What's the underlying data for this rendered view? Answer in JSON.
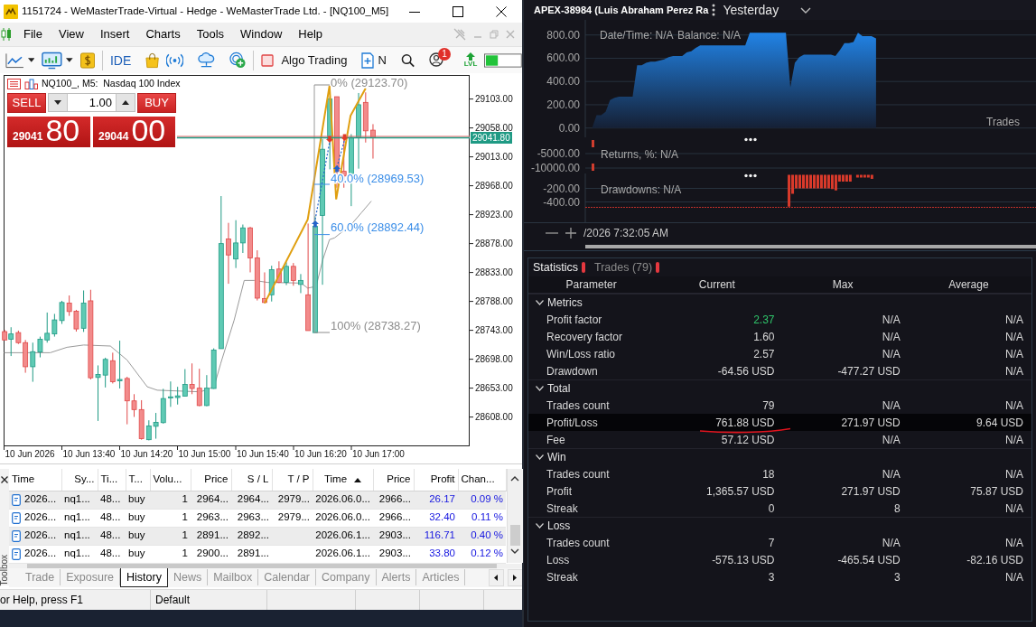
{
  "window": {
    "title": "1151724 - WeMasterTrade-Virtual - Hedge - WeMasterTrade Ltd. - [NQ100_M5]"
  },
  "menu": [
    "File",
    "View",
    "Insert",
    "Charts",
    "Tools",
    "Window",
    "Help"
  ],
  "toolbar": {
    "ide": "IDE",
    "algo_trading": {
      "label": "Algo Trading",
      "on": false
    },
    "new_order": "N",
    "notifications": "1",
    "level_badge": "LVL"
  },
  "chart": {
    "title": "NQ100_, M5:  Nasdaq 100 Index",
    "one_click": {
      "sell": "SELL",
      "buy": "BUY",
      "volume": "1.00",
      "bid": {
        "main": "29041",
        "pips": "80"
      },
      "ask": {
        "main": "29044",
        "pips": "00"
      }
    },
    "price_ticks": [
      "29103.00",
      "29058.00",
      "29013.00",
      "28968.00",
      "28923.00",
      "28878.00",
      "28833.00",
      "28788.00",
      "28743.00",
      "28698.00",
      "28653.00",
      "28608.00"
    ],
    "current_price": "29041.80",
    "time_ticks": [
      "10 Jun 2026",
      "10 Jun 13:40",
      "10 Jun 14:20",
      "10 Jun 15:00",
      "10 Jun 15:40",
      "10 Jun 16:20",
      "10 Jun 17:00"
    ],
    "fibonacci": [
      {
        "label": "0% (29123.70)",
        "kind": "edge"
      },
      {
        "label": "40.0% (28969.53)",
        "kind": "inner"
      },
      {
        "label": "60.0% (28892.44)",
        "kind": "inner"
      },
      {
        "label": "100% (28738.27)",
        "kind": "edge"
      }
    ]
  },
  "toolbox": {
    "side_label": "Toolbox",
    "columns": [
      {
        "label": "Time",
        "sorted": false
      },
      {
        "label": "Sy...",
        "sorted": false
      },
      {
        "label": "Ti...",
        "sorted": false
      },
      {
        "label": "T...",
        "sorted": false
      },
      {
        "label": "Volu...",
        "sorted": false
      },
      {
        "label": "Price",
        "sorted": false
      },
      {
        "label": "S / L",
        "sorted": false
      },
      {
        "label": "T / P",
        "sorted": false
      },
      {
        "label": "Time",
        "sorted": true
      },
      {
        "label": "Price",
        "sorted": false
      },
      {
        "label": "Profit",
        "sorted": false
      },
      {
        "label": "Chan...",
        "sorted": false
      }
    ],
    "rows": [
      [
        "2026...",
        "nq1...",
        "48...",
        "buy",
        "1",
        "2964...",
        "2964...",
        "2979...",
        "2026.06.0...",
        "2966...",
        "26.17",
        "0.09 %"
      ],
      [
        "2026...",
        "nq1...",
        "48...",
        "buy",
        "1",
        "2963...",
        "2963...",
        "2979...",
        "2026.06.0...",
        "2966...",
        "32.40",
        "0.11 %"
      ],
      [
        "2026...",
        "nq1...",
        "48...",
        "buy",
        "1",
        "2891...",
        "2892...",
        null,
        "2026.06.1...",
        "2903...",
        "116.71",
        "0.40 %"
      ],
      [
        "2026...",
        "nq1...",
        "48...",
        "buy",
        "1",
        "2900...",
        "2891...",
        null,
        "2026.06.1...",
        "2903...",
        "33.80",
        "0.12 %"
      ]
    ],
    "tabs": [
      {
        "label": "Trade",
        "selected": false
      },
      {
        "label": "Exposure",
        "selected": false
      },
      {
        "label": "History",
        "selected": true
      },
      {
        "label": "News",
        "selected": false
      },
      {
        "label": "Mailbox",
        "selected": false
      },
      {
        "label": "Calendar",
        "selected": false
      },
      {
        "label": "Company",
        "selected": false
      },
      {
        "label": "Alerts",
        "selected": false
      },
      {
        "label": "Articles",
        "selected": false
      }
    ]
  },
  "status_bar": [
    "or Help, press F1",
    "Default"
  ],
  "report": {
    "account": "APEX-38984 (Luis Abraham Perez Ra",
    "period": "Yesterday",
    "equity": {
      "info": [
        "Date/Time: N/A",
        "Balance: N/A"
      ],
      "axis_title": "Trades",
      "chart_data": {
        "type": "area",
        "categories": [
          null,
          null,
          null,
          null,
          null,
          null,
          null,
          null,
          null,
          null,
          null,
          null,
          null,
          null,
          null,
          null,
          null,
          null,
          null,
          null,
          null,
          null,
          null,
          null,
          null,
          null,
          null,
          null,
          null,
          null,
          null,
          null,
          null,
          null,
          null,
          null,
          null,
          null,
          null,
          null,
          null,
          null,
          null,
          null,
          null,
          null,
          null,
          null,
          null,
          null,
          null,
          null,
          null,
          null,
          null,
          null,
          null,
          null,
          null,
          null,
          null,
          null,
          null,
          null,
          null,
          null,
          null,
          null,
          null,
          null,
          null,
          null,
          null,
          null,
          null,
          null,
          null,
          null,
          null,
          null,
          null,
          null,
          null,
          null,
          null,
          null,
          null,
          null,
          null,
          null,
          null,
          null,
          null,
          null,
          null,
          null,
          null,
          null,
          null,
          null
        ],
        "values": [
          0,
          0,
          110,
          110,
          140,
          240,
          260,
          270,
          270,
          270,
          270,
          540,
          540,
          560,
          570,
          570,
          580,
          590,
          610,
          620,
          620,
          620,
          650,
          660,
          690,
          710,
          710,
          710,
          710,
          710,
          710,
          710,
          710,
          710,
          710,
          710,
          820,
          820,
          820,
          820,
          820,
          820,
          820,
          820,
          820,
          350,
          560,
          610,
          630,
          630,
          630,
          630,
          630,
          630,
          630,
          620,
          670,
          730,
          730,
          740,
          820,
          790,
          790,
          790,
          770,
          null,
          null,
          null,
          null,
          null,
          null,
          null,
          null,
          null,
          null,
          null,
          null,
          null,
          null,
          null,
          null,
          null,
          null,
          null,
          null,
          null,
          null,
          null,
          null,
          null,
          null,
          null,
          null,
          null,
          null,
          null,
          null,
          null,
          null,
          null
        ],
        "ylim": [
          -80,
          930
        ],
        "yticks": [
          {
            "value": 800,
            "label": "800.00"
          },
          {
            "value": 600,
            "label": "600.00"
          },
          {
            "value": 400,
            "label": "400.00"
          },
          {
            "value": 200,
            "label": "200.00"
          },
          {
            "value": 0,
            "label": "0.00"
          }
        ],
        "grid": true
      }
    },
    "returns": {
      "info": "Returns, %: N/A",
      "tick_labels": [
        "-5000.00",
        "-10000.00"
      ]
    },
    "drawdowns": {
      "info": "Drawdowns: N/A",
      "chart_data": {
        "type": "bar",
        "categories": [
          null,
          null,
          null,
          null,
          null,
          null,
          null,
          null,
          null,
          null,
          null,
          null,
          null,
          null,
          null,
          null,
          null,
          null,
          null,
          null,
          null,
          null,
          null,
          null,
          null,
          null,
          null,
          null,
          null,
          null,
          null,
          null,
          null,
          null,
          null,
          null,
          null,
          null,
          null,
          null,
          null,
          null,
          null,
          null,
          null,
          null,
          null,
          null,
          null,
          null,
          null,
          null,
          null,
          null,
          null,
          null,
          null,
          null,
          null,
          null,
          null,
          null,
          null,
          null,
          null,
          null,
          null,
          null,
          null,
          null,
          null,
          null,
          null,
          null,
          null,
          null,
          null,
          null,
          null,
          null,
          null,
          null,
          null,
          null,
          null,
          null,
          null,
          null,
          null,
          null,
          null,
          null,
          null,
          null,
          null,
          null,
          null,
          null,
          null,
          null,
          null,
          null,
          null,
          null,
          null,
          null,
          null,
          null,
          null,
          null,
          null,
          null,
          null,
          null,
          null,
          null,
          null,
          null,
          null,
          null,
          null,
          null,
          null,
          null,
          null
        ],
        "values": [
          null,
          null,
          null,
          null,
          null,
          null,
          null,
          null,
          null,
          null,
          null,
          null,
          null,
          null,
          null,
          null,
          null,
          null,
          null,
          null,
          null,
          null,
          null,
          null,
          null,
          null,
          null,
          null,
          null,
          null,
          null,
          null,
          null,
          null,
          null,
          null,
          null,
          null,
          null,
          null,
          null,
          null,
          null,
          null,
          null,
          null,
          null,
          null,
          null,
          null,
          null,
          null,
          null,
          null,
          null,
          null,
          -470,
          -280,
          -200,
          -200,
          -200,
          -200,
          -200,
          -200,
          -200,
          -200,
          -200,
          -200,
          -210,
          -230,
          -100,
          -100,
          -100,
          -100,
          null,
          -40,
          -40,
          -40,
          -40,
          -60,
          null,
          null,
          null,
          null,
          null,
          null,
          null,
          null,
          null,
          null,
          null,
          null,
          null,
          null,
          null,
          null,
          null,
          null,
          null,
          null,
          null,
          null,
          null,
          null,
          null,
          null,
          null,
          null,
          null,
          null,
          null,
          null,
          null,
          null,
          null,
          null,
          null,
          null,
          null,
          null,
          null,
          null,
          null,
          null,
          null
        ],
        "ylim": [
          -700,
          20
        ],
        "yticks": [
          {
            "value": -200,
            "label": "-200.00"
          },
          {
            "value": -400,
            "label": "-400.00"
          }
        ],
        "grid": true,
        "ref_lines": [
          {
            "axis": "y",
            "value": -480
          }
        ]
      }
    },
    "timestamp": "/2026 7:32:05 AM",
    "stats": {
      "tabs": [
        {
          "label": "Statistics",
          "selected": true
        },
        {
          "label": "Trades (79)",
          "selected": false
        }
      ],
      "columns": [
        "Parameter",
        "Current",
        "Max",
        "Average"
      ],
      "groups": [
        {
          "title": "Metrics",
          "expanded": true,
          "rows": [
            {
              "parameter": "Profit factor",
              "current": "2.37",
              "max": "N/A",
              "average": "N/A",
              "selected": false,
              "positive": true,
              "underlined": false
            },
            {
              "parameter": "Recovery factor",
              "current": "1.60",
              "max": "N/A",
              "average": "N/A",
              "selected": false,
              "positive": false,
              "underlined": false
            },
            {
              "parameter": "Win/Loss ratio",
              "current": "2.57",
              "max": "N/A",
              "average": "N/A",
              "selected": false,
              "positive": false,
              "underlined": false
            },
            {
              "parameter": "Drawdown",
              "current": "-64.56 USD",
              "max": "-477.27 USD",
              "average": "N/A",
              "selected": false,
              "positive": false,
              "underlined": false
            }
          ]
        },
        {
          "title": "Total",
          "expanded": true,
          "rows": [
            {
              "parameter": "Trades count",
              "current": "79",
              "max": "N/A",
              "average": "N/A",
              "selected": false,
              "positive": false,
              "underlined": false
            },
            {
              "parameter": "Profit/Loss",
              "current": "761.88 USD",
              "max": "271.97 USD",
              "average": "9.64 USD",
              "selected": true,
              "positive": false,
              "underlined": true
            },
            {
              "parameter": "Fee",
              "current": "57.12 USD",
              "max": "N/A",
              "average": "N/A",
              "selected": false,
              "positive": false,
              "underlined": false
            }
          ]
        },
        {
          "title": "Win",
          "expanded": true,
          "rows": [
            {
              "parameter": "Trades count",
              "current": "18",
              "max": "N/A",
              "average": "N/A",
              "selected": false,
              "positive": false,
              "underlined": false
            },
            {
              "parameter": "Profit",
              "current": "1,365.57 USD",
              "max": "271.97 USD",
              "average": "75.87 USD",
              "selected": false,
              "positive": false,
              "underlined": false
            },
            {
              "parameter": "Streak",
              "current": "0",
              "max": "8",
              "average": "N/A",
              "selected": false,
              "positive": false,
              "underlined": false
            }
          ]
        },
        {
          "title": "Loss",
          "expanded": true,
          "rows": [
            {
              "parameter": "Trades count",
              "current": "7",
              "max": "N/A",
              "average": "N/A",
              "selected": false,
              "positive": false,
              "underlined": false
            },
            {
              "parameter": "Loss",
              "current": "-575.13 USD",
              "max": "-465.54 USD",
              "average": "-82.16 USD",
              "selected": false,
              "positive": false,
              "underlined": false
            },
            {
              "parameter": "Streak",
              "current": "3",
              "max": "3",
              "average": "N/A",
              "selected": false,
              "positive": false,
              "underlined": false
            }
          ]
        }
      ]
    }
  }
}
